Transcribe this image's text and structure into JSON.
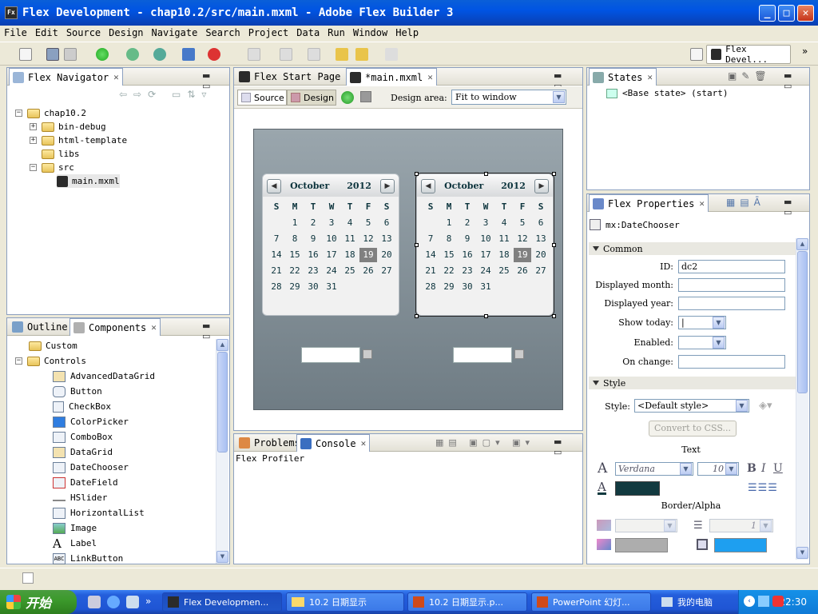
{
  "window": {
    "title": "Flex Development - chap10.2/src/main.mxml - Adobe Flex Builder 3",
    "app_icon": "Fx"
  },
  "menu": [
    "File",
    "Edit",
    "Source",
    "Design",
    "Navigate",
    "Search",
    "Project",
    "Data",
    "Run",
    "Window",
    "Help"
  ],
  "perspective": {
    "label": "Flex Devel...",
    "more": "»"
  },
  "navigator": {
    "tab": "Flex Navigator",
    "tree": [
      {
        "label": "chap10.2"
      },
      {
        "label": "bin-debug"
      },
      {
        "label": "html-template"
      },
      {
        "label": "libs"
      },
      {
        "label": "src"
      },
      {
        "label": "main.mxml"
      }
    ]
  },
  "components_panel": {
    "tabs": [
      "Outline",
      "Components"
    ],
    "groups": [
      "Custom",
      "Controls"
    ],
    "items": [
      "AdvancedDataGrid",
      "Button",
      "CheckBox",
      "ColorPicker",
      "ComboBox",
      "DataGrid",
      "DateChooser",
      "DateField",
      "HSlider",
      "HorizontalList",
      "Image",
      "Label",
      "LinkButton"
    ]
  },
  "editor": {
    "tabs": [
      "Flex Start Page",
      "*main.mxml"
    ],
    "source_label": "Source",
    "design_label": "Design",
    "design_area_label": "Design area:",
    "design_area_value": "Fit to window",
    "calendars": [
      {
        "month": "October",
        "year": "2012"
      },
      {
        "month": "October",
        "year": "2012"
      }
    ],
    "day_headers": [
      "S",
      "M",
      "T",
      "W",
      "T",
      "F",
      "S"
    ],
    "weeks": [
      [
        "",
        "1",
        "2",
        "3",
        "4",
        "5",
        "6"
      ],
      [
        "7",
        "8",
        "9",
        "10",
        "11",
        "12",
        "13"
      ],
      [
        "14",
        "15",
        "16",
        "17",
        "18",
        "19",
        "20"
      ],
      [
        "21",
        "22",
        "23",
        "24",
        "25",
        "26",
        "27"
      ],
      [
        "28",
        "29",
        "30",
        "31",
        "",
        "",
        ""
      ]
    ],
    "selected_day": "19"
  },
  "bottom_panel": {
    "tabs": [
      "Problems",
      "Console"
    ],
    "content": "Flex Profiler"
  },
  "states": {
    "tab": "States",
    "item": "<Base state> (start)"
  },
  "properties": {
    "tab": "Flex Properties",
    "component": "mx:DateChooser",
    "common_section": "Common",
    "fields": [
      {
        "label": "ID:",
        "value": "dc2"
      },
      {
        "label": "Displayed month:",
        "value": ""
      },
      {
        "label": "Displayed year:",
        "value": ""
      },
      {
        "label": "Show today:",
        "value": "|"
      },
      {
        "label": "Enabled:",
        "value": ""
      },
      {
        "label": "On change:",
        "value": ""
      }
    ],
    "style_section": "Style",
    "style_label": "Style:",
    "style_value": "<Default style>",
    "convert_css": "Convert to CSS...",
    "text_header": "Text",
    "font": "Verdana",
    "font_size": "10",
    "text_color": "#123a40",
    "border_header": "Border/Alpha",
    "border_size": "1",
    "fill_color": "#1e9ff0"
  },
  "taskbar": {
    "start": "开始",
    "tasks": [
      "Flex Developmen...",
      "10.2 日期显示",
      "10.2 日期显示.p...",
      "PowerPoint 幻灯...",
      "我的电脑"
    ],
    "clock": "22:30"
  }
}
